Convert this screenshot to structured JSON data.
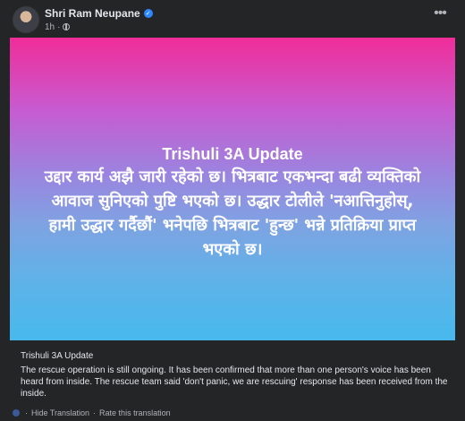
{
  "post": {
    "author": "Shri Ram Neupane",
    "time": "1h",
    "verified_icon": "verified-badge-icon",
    "audience_icon": "globe-icon",
    "more_icon": "more-options-icon",
    "more_symbol": "•••"
  },
  "banner": {
    "title": "Trishuli 3A Update",
    "body": "उद्दार कार्य अझै जारी रहेको छ। भित्रबाट एकभन्दा बढी व्यक्तिको आवाज सुनिएको पुष्टि भएको छ। उद्धार टोलीले 'नआत्तिनुहोस्, हामी उद्धार गर्दैछौं' भनेपछि भित्रबाट 'हुन्छ' भन्ने प्रतिक्रिया प्राप्त भएको छ।",
    "gradient": [
      "#f02d99",
      "#47b9ed"
    ]
  },
  "translation": {
    "title": "Trishuli 3A Update",
    "body": "The rescue operation is still ongoing. It has been confirmed that more than one person's voice has been heard from inside. The rescue team said 'don't panic, we are rescuing' response has been received from the inside.",
    "hide_label": "Hide Translation",
    "separator": "·",
    "rate_label": "Rate this translation"
  }
}
